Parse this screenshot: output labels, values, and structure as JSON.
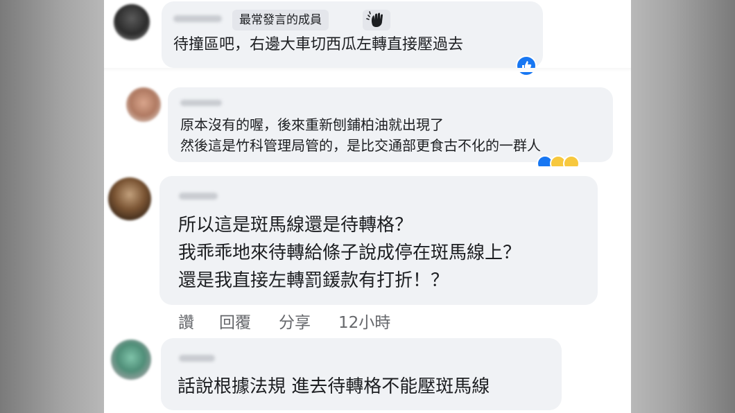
{
  "comments": [
    {
      "badge_label": "最常發言的成員",
      "lines": [
        "待撞區吧，右邊大車切西瓜左轉直接壓過去"
      ]
    },
    {
      "lines": [
        "原本沒有的喔，後來重新刨鋪柏油就出現了",
        "然後這是竹科管理局管的，是比交通部更食古不化的一群人"
      ]
    },
    {
      "lines": [
        "所以這是斑馬線還是待轉格？",
        "我乖乖地來待轉給條子說成停在斑馬線上？",
        "還是我直接左轉罰鍰款有打折！？"
      ],
      "actions": {
        "like": "讚",
        "reply": "回覆",
        "share": "分享",
        "time": "12小時"
      }
    },
    {
      "lines": [
        "話說根據法規 進去待轉格不能壓斑馬線"
      ]
    }
  ],
  "colors": {
    "bubble": "#f0f2f5",
    "text": "#1c1e21",
    "muted": "#65676b",
    "like_blue": "#1877f2"
  }
}
